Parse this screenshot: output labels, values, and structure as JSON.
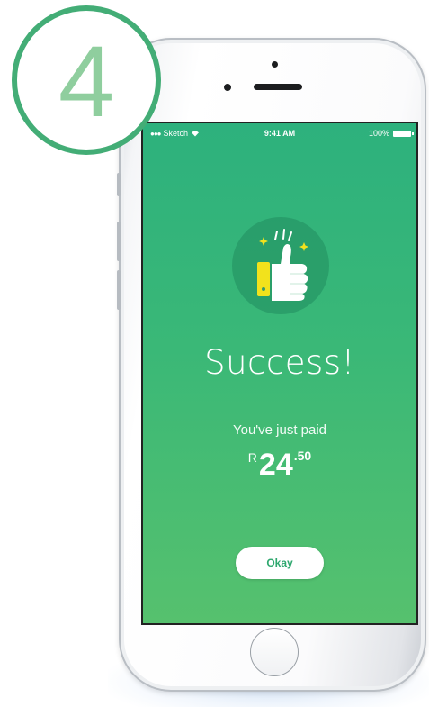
{
  "step_badge": {
    "number": "4"
  },
  "status_bar": {
    "carrier": "Sketch",
    "time": "9:41 AM",
    "battery": "100%"
  },
  "success": {
    "title": "Success!",
    "subtitle": "You've just paid",
    "amount": {
      "currency": "R",
      "main": "24",
      "cents": ".50"
    },
    "okay_label": "Okay"
  },
  "icons": {
    "thumb": "thumbs-up-icon",
    "wifi": "wifi-icon",
    "battery": "battery-icon",
    "home": "home-button"
  },
  "colors": {
    "badge_ring": "#43ad76",
    "badge_number": "#8fce9e",
    "screen_top": "#2db17d",
    "screen_bottom": "#56c16e",
    "thumb_cuff": "#f2e21c",
    "button_text": "#2fa86f"
  }
}
